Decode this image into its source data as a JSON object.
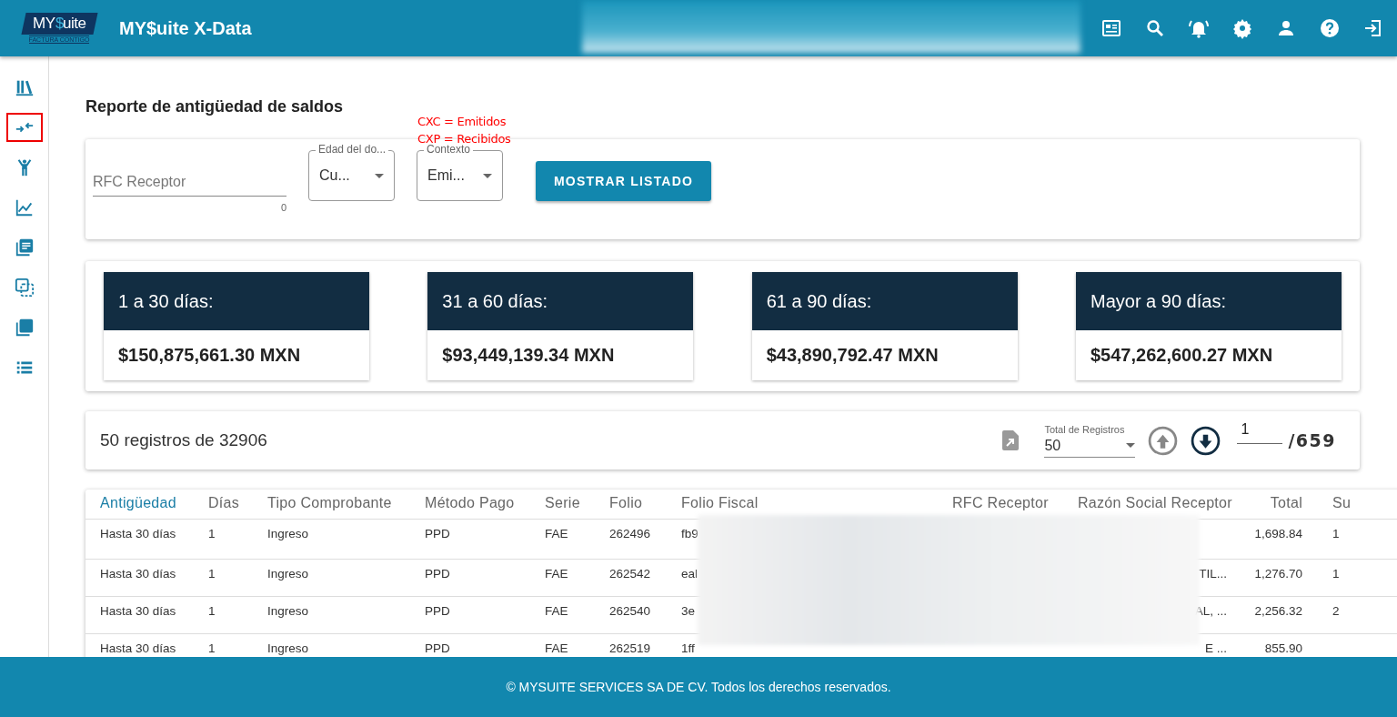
{
  "header": {
    "logo_parts": [
      {
        "text": "MY",
        "color": "#ffffff"
      },
      {
        "text": "$",
        "color": "#3bb4dc"
      },
      {
        "text": "uite",
        "color": "#ffffff"
      }
    ],
    "logo_tagline": "FACTURA CONTIGO",
    "app_title": "MY$uite X-Data"
  },
  "sidebar": {
    "items": [
      {
        "selected": false
      },
      {
        "selected": true
      },
      {
        "selected": false
      },
      {
        "selected": false
      },
      {
        "selected": false
      },
      {
        "selected": false
      },
      {
        "selected": false
      },
      {
        "selected": false
      }
    ]
  },
  "page_title": "Reporte de antigüedad de saldos",
  "annotation": [
    "CXC = Emitidos",
    "CXP = Recibidos"
  ],
  "filters": {
    "rfc_field": {
      "placeholder": "RFC Receptor",
      "counter": "0"
    },
    "selects": [
      {
        "label": "Edad del do...",
        "value": "Cu..."
      },
      {
        "label": "Contexto",
        "value": "Emi..."
      }
    ],
    "button": "MOSTRAR LISTADO"
  },
  "summary": [
    {
      "title": "1 a 30 días:",
      "amount": "$150,875,661.30 MXN"
    },
    {
      "title": "31 a 60 días:",
      "amount": "$93,449,139.34 MXN"
    },
    {
      "title": "61 a 90 días:",
      "amount": "$43,890,792.47 MXN"
    },
    {
      "title": "Mayor a 90 días:",
      "amount": "$547,262,600.27 MXN"
    }
  ],
  "pager": {
    "count_text": "50 registros de 32906",
    "page_size": {
      "label": "Total de Registros",
      "value": "50"
    },
    "prev_disabled": true,
    "next_disabled": false,
    "page": "1",
    "total_pages": "/659"
  },
  "table": {
    "columns": [
      {
        "label": "Antigüedad",
        "sorted": true
      },
      {
        "label": "Días",
        "sorted": false
      },
      {
        "label": "Tipo Comprobante",
        "sorted": false
      },
      {
        "label": "Método Pago",
        "sorted": false
      },
      {
        "label": "Serie",
        "sorted": false
      },
      {
        "label": "Folio",
        "sorted": false
      },
      {
        "label": "Folio Fiscal",
        "sorted": false
      },
      {
        "label": "RFC Receptor",
        "sorted": false
      },
      {
        "label": "Razón Social Receptor",
        "sorted": false
      },
      {
        "label": "Total",
        "sorted": false
      },
      {
        "label": "Su",
        "sorted": false
      }
    ],
    "rows": [
      [
        "Hasta 30 días",
        "1",
        "Ingreso",
        "PPD",
        "FAE",
        "262496",
        "fb9",
        "",
        "",
        "1,698.84",
        "1"
      ],
      [
        "Hasta 30 días",
        "1",
        "Ingreso",
        "PPD",
        "FAE",
        "262542",
        "eal",
        "",
        "TIL...",
        "1,276.70",
        "1"
      ],
      [
        "Hasta 30 días",
        "1",
        "Ingreso",
        "PPD",
        "FAE",
        "262540",
        "3e",
        "",
        "AL, ...",
        "2,256.32",
        "2"
      ],
      [
        "Hasta 30 días",
        "1",
        "Ingreso",
        "PPD",
        "FAE",
        "262519",
        "1ff",
        "",
        "E ...",
        "855.90",
        ""
      ]
    ]
  },
  "footer": "© MYSUITE SERVICES SA DE CV. Todos los derechos reservados."
}
